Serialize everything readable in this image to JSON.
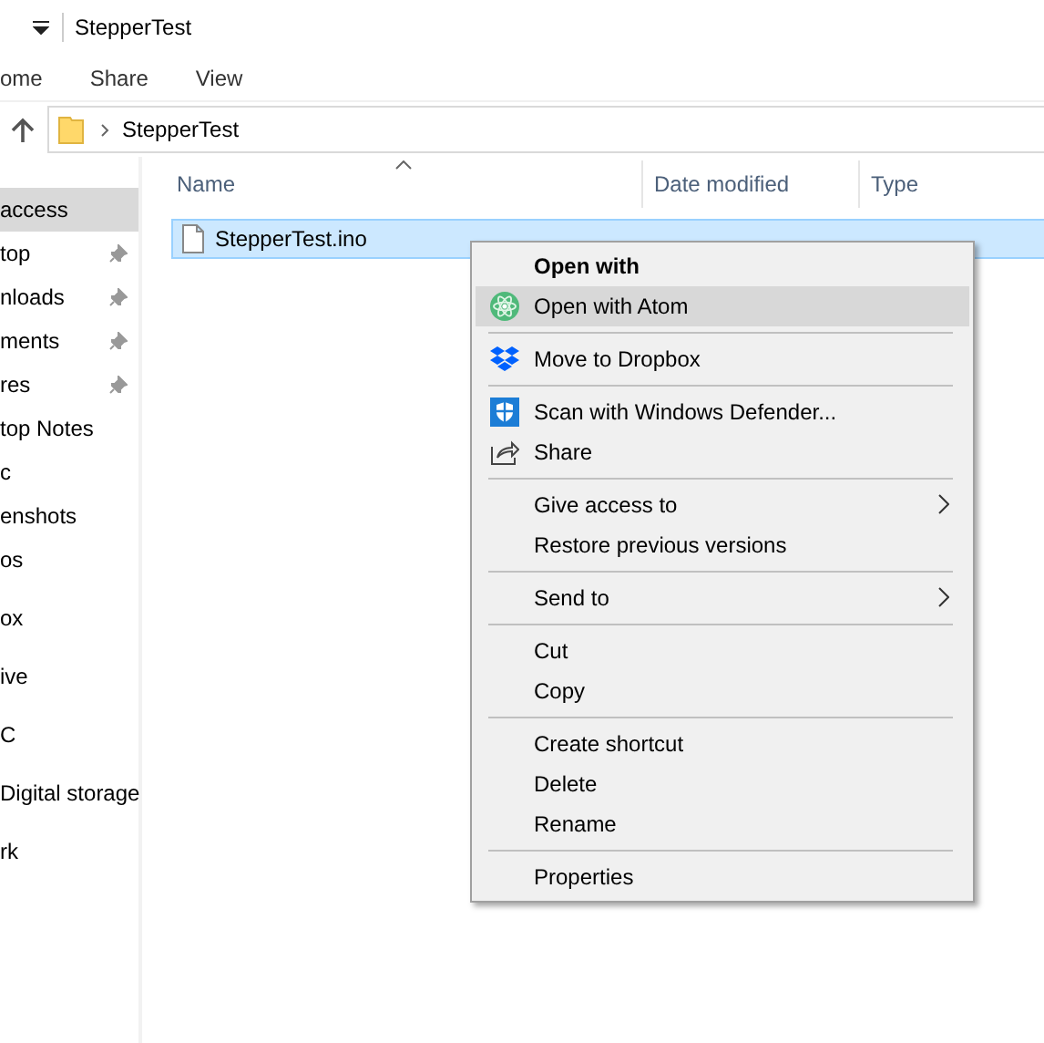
{
  "title_bar": {
    "title": "StepperTest"
  },
  "ribbon_tabs": [
    {
      "label": "ome"
    },
    {
      "label": "Share"
    },
    {
      "label": "View"
    }
  ],
  "address_bar": {
    "path": [
      "StepperTest"
    ]
  },
  "sidebar": {
    "groups": [
      [
        {
          "label": "access",
          "selected": true,
          "pinned": false
        },
        {
          "label": "top",
          "selected": false,
          "pinned": true
        },
        {
          "label": "nloads",
          "selected": false,
          "pinned": true
        },
        {
          "label": "ments",
          "selected": false,
          "pinned": true
        },
        {
          "label": "res",
          "selected": false,
          "pinned": true
        },
        {
          "label": "top Notes",
          "selected": false,
          "pinned": false
        },
        {
          "label": "c",
          "selected": false,
          "pinned": false
        },
        {
          "label": "enshots",
          "selected": false,
          "pinned": false
        },
        {
          "label": "os",
          "selected": false,
          "pinned": false
        }
      ],
      [
        {
          "label": "ox",
          "selected": false,
          "pinned": false
        }
      ],
      [
        {
          "label": "ive",
          "selected": false,
          "pinned": false
        }
      ],
      [
        {
          "label": "C",
          "selected": false,
          "pinned": false
        }
      ],
      [
        {
          "label": "Digital storage",
          "selected": false,
          "pinned": false
        }
      ],
      [
        {
          "label": "rk",
          "selected": false,
          "pinned": false
        }
      ]
    ]
  },
  "file_list": {
    "columns": [
      {
        "label": "Name",
        "sorted": true
      },
      {
        "label": "Date modified",
        "sorted": false
      },
      {
        "label": "Type",
        "sorted": false
      }
    ],
    "rows": [
      {
        "name": "StepperTest.ino",
        "selected": true
      }
    ]
  },
  "context_menu": {
    "sections": [
      [
        {
          "label": "Open with",
          "kind": "header",
          "selected": false,
          "submenu": false
        },
        {
          "label": "Open with Atom",
          "kind": "atom",
          "selected": true,
          "submenu": false
        }
      ],
      [
        {
          "label": "Move to Dropbox",
          "kind": "dropbox",
          "selected": false,
          "submenu": false
        }
      ],
      [
        {
          "label": "Scan with Windows Defender...",
          "kind": "shield",
          "selected": false,
          "submenu": false
        },
        {
          "label": "Share",
          "kind": "share",
          "selected": false,
          "submenu": false
        }
      ],
      [
        {
          "label": "Give access to",
          "kind": "plain",
          "selected": false,
          "submenu": true
        },
        {
          "label": "Restore previous versions",
          "kind": "plain",
          "selected": false,
          "submenu": false
        }
      ],
      [
        {
          "label": "Send to",
          "kind": "plain",
          "selected": false,
          "submenu": true
        }
      ],
      [
        {
          "label": "Cut",
          "kind": "plain",
          "selected": false,
          "submenu": false
        },
        {
          "label": "Copy",
          "kind": "plain",
          "selected": false,
          "submenu": false
        }
      ],
      [
        {
          "label": "Create shortcut",
          "kind": "plain",
          "selected": false,
          "submenu": false
        },
        {
          "label": "Delete",
          "kind": "plain",
          "selected": false,
          "submenu": false
        },
        {
          "label": "Rename",
          "kind": "plain",
          "selected": false,
          "submenu": false
        }
      ],
      [
        {
          "label": "Properties",
          "kind": "plain",
          "selected": false,
          "submenu": false
        }
      ]
    ]
  }
}
